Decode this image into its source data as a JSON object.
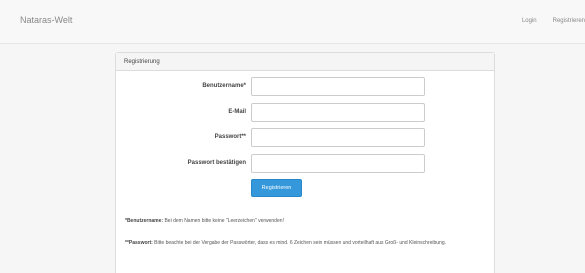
{
  "navbar": {
    "brand": "Nataras-Welt",
    "links": [
      "Login",
      "Registrieren"
    ]
  },
  "panel": {
    "heading": "Registrierung",
    "fields": [
      {
        "label": "Benutzername*",
        "value": "",
        "placeholder": ""
      },
      {
        "label": "E-Mail",
        "value": "",
        "placeholder": ""
      },
      {
        "label": "Passwort**",
        "value": "",
        "placeholder": ""
      },
      {
        "label": "Passwort bestätigen",
        "value": "",
        "placeholder": ""
      }
    ],
    "submit_label": "Registrieren",
    "note1_bold": "*Benutzername:",
    "note1_text": " Bei dem Namen bitte keine \"Leerzeichen\" verwenden!",
    "note2_bold": "**Passwort:",
    "note2_text": " Bitte beachte bei der Vergabe der Passwörter, dass es mind. 6 Zeichen sein müssen und vorteilhaft aus Groß- und Kleinschreibung."
  },
  "colors": {
    "primary_button": "#3498db",
    "page_background": "#f6f6f6"
  }
}
